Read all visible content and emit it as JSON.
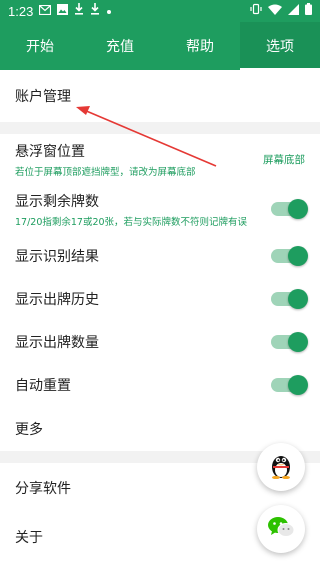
{
  "status_bar": {
    "time": "1:23",
    "left_icons": [
      "gmail-icon",
      "image-icon",
      "download-icon",
      "download-icon",
      "dot-icon"
    ],
    "right_icons": [
      "vibrate-icon",
      "wifi-icon",
      "signal-icon",
      "battery-icon"
    ]
  },
  "tabs": [
    {
      "label": "开始",
      "active": false
    },
    {
      "label": "充值",
      "active": false
    },
    {
      "label": "帮助",
      "active": false
    },
    {
      "label": "选项",
      "active": true
    }
  ],
  "settings": {
    "account": {
      "title": "账户管理"
    },
    "float_window": {
      "title": "悬浮窗位置",
      "subtitle": "若位于屏幕顶部遮挡牌型，请改为屏幕底部",
      "value": "屏幕底部"
    },
    "remaining": {
      "title": "显示剩余牌数",
      "subtitle": "17/20指剩余17或20张，若与实际牌数不符则记牌有误",
      "on": true
    },
    "recognition": {
      "title": "显示识别结果",
      "on": true
    },
    "history": {
      "title": "显示出牌历史",
      "on": true
    },
    "count": {
      "title": "显示出牌数量",
      "on": true
    },
    "auto_reset": {
      "title": "自动重置",
      "on": true
    },
    "more": {
      "title": "更多"
    },
    "share": {
      "title": "分享软件"
    },
    "about": {
      "title": "关于"
    }
  },
  "colors": {
    "brand": "#1e9d5f",
    "annotation_arrow": "#e53935"
  }
}
